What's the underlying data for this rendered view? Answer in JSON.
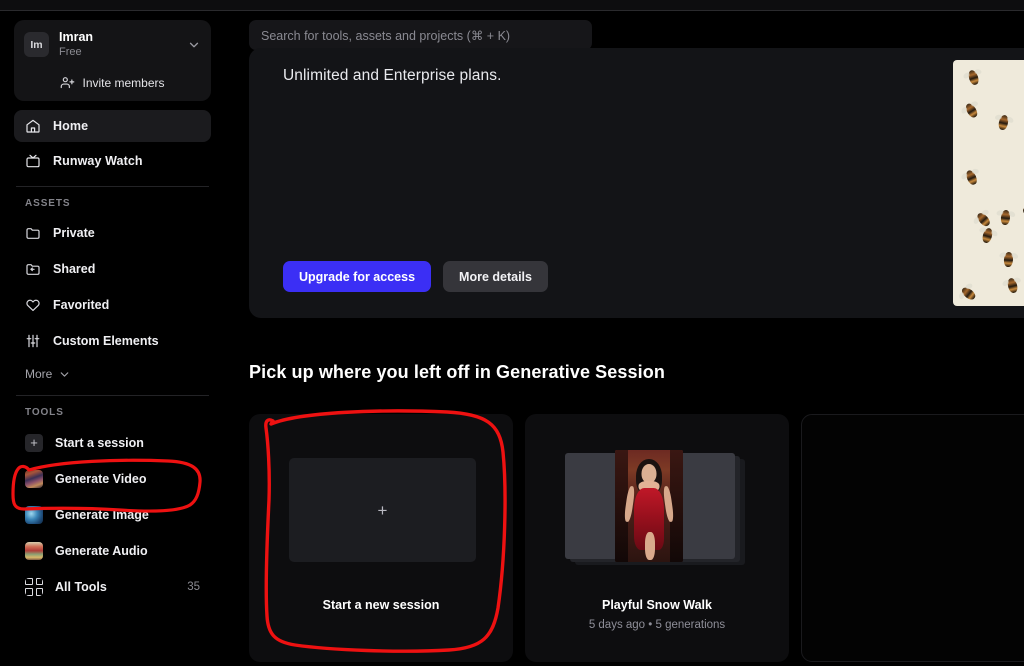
{
  "app": {
    "name": "Runway",
    "accent_blue": "#3b2ff5",
    "annotation_color": "#ee1111",
    "background": "#000000"
  },
  "sidebar": {
    "account": {
      "avatar_initials": "Im",
      "name": "Imran",
      "plan": "Free",
      "chevron_icon": "chevron-down-icon",
      "invite_label": "Invite members",
      "invite_icon": "add-person-icon"
    },
    "nav": [
      {
        "label": "Home",
        "icon": "home-icon",
        "active": true
      },
      {
        "label": "Runway Watch",
        "icon": "tv-icon",
        "active": false
      }
    ],
    "assets": {
      "section_label": "ASSETS",
      "items": [
        {
          "label": "Private",
          "icon": "folder-icon"
        },
        {
          "label": "Shared",
          "icon": "folder-shared-icon"
        },
        {
          "label": "Favorited",
          "icon": "heart-icon"
        },
        {
          "label": "Custom Elements",
          "icon": "sliders-icon"
        }
      ],
      "more_label": "More",
      "more_icon": "chevron-down-icon"
    },
    "tools": {
      "section_label": "TOOLS",
      "items": [
        {
          "label": "Start a session",
          "icon": "plus-thumbnail-icon",
          "count": ""
        },
        {
          "label": "Generate Video",
          "icon": "video-thumbnail-icon",
          "count": ""
        },
        {
          "label": "Generate Image",
          "icon": "image-thumbnail-icon",
          "count": ""
        },
        {
          "label": "Generate Audio",
          "icon": "audio-thumbnail-icon",
          "count": ""
        },
        {
          "label": "All Tools",
          "icon": "grid-icon",
          "count": "35"
        }
      ]
    }
  },
  "topbar": {
    "search": {
      "placeholder": "Search for tools, assets and projects (⌘ + K)",
      "value": ""
    }
  },
  "banner": {
    "text": "Unlimited and Enterprise plans.",
    "primary_button": "Upgrade for access",
    "secondary_button": "More details",
    "photo_name": "bees-photo"
  },
  "main": {
    "section_title": "Pick up where you left off in Generative Session",
    "cards": [
      {
        "type": "new-session",
        "title": "Start a new session",
        "meta": "",
        "plus_icon": "plus-icon"
      },
      {
        "type": "session",
        "title": "Playful Snow Walk",
        "meta": "5 days ago • 5 generations"
      },
      {
        "type": "empty",
        "title": "",
        "meta": ""
      }
    ]
  },
  "annotations": [
    {
      "name": "start-a-session-circle",
      "color": "#ee1111"
    },
    {
      "name": "start-new-session-card-circle",
      "color": "#ee1111"
    }
  ]
}
